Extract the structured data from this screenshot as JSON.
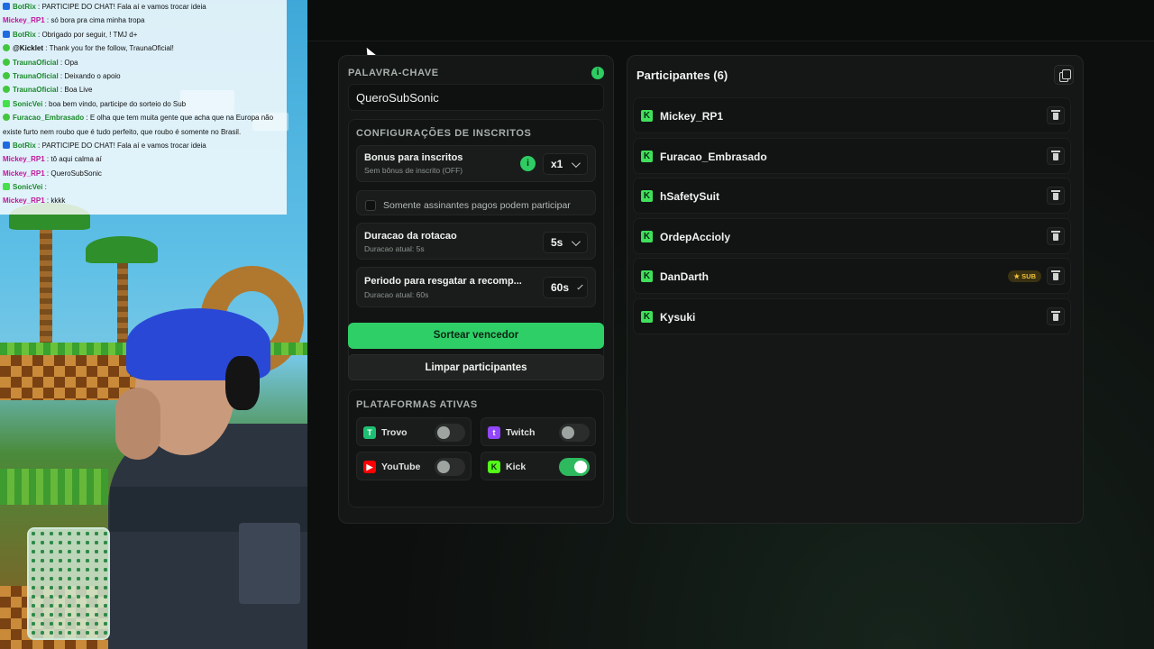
{
  "chat": [
    {
      "icon": "bot",
      "name": "BotRix",
      "name_color": "#1a8a2a",
      "text": "PARTICIPE DO CHAT! Fala aí e vamos trocar ideia"
    },
    {
      "icon": "none",
      "name": "Mickey_RP1",
      "name_color": "#c0159a",
      "text": "só bora pra cima minha tropa"
    },
    {
      "icon": "bot",
      "name": "BotRix",
      "name_color": "#1a8a2a",
      "text": "Obrigado por seguir, ! TMJ d+"
    },
    {
      "icon": "dot",
      "name": "@Kicklet",
      "name_color": "#111111",
      "text": "Thank you for the follow, TraunaOficial!"
    },
    {
      "icon": "dot",
      "name": "TraunaOficial",
      "name_color": "#1a8a2a",
      "text": "Opa"
    },
    {
      "icon": "dot",
      "name": "TraunaOficial",
      "name_color": "#1a8a2a",
      "text": "Deixando o apoio"
    },
    {
      "icon": "dot",
      "name": "TraunaOficial",
      "name_color": "#1a8a2a",
      "text": "Boa Live"
    },
    {
      "icon": "k",
      "name": "SonicVei",
      "name_color": "#1a8a2a",
      "text": "boa bem vindo, participe do sorteio do Sub"
    },
    {
      "icon": "dot",
      "name": "Furacao_Embrasado",
      "name_color": "#1a8a2a",
      "text": "E olha que tem muita gente que acha que na Europa não"
    },
    {
      "icon": "none",
      "name": "",
      "name_color": "#111111",
      "text": "existe furto nem roubo que é tudo perfeito, que roubo é somente no Brasil."
    },
    {
      "icon": "bot",
      "name": "BotRix",
      "name_color": "#1a8a2a",
      "text": "PARTICIPE DO CHAT! Fala aí e vamos trocar ideia"
    },
    {
      "icon": "none",
      "name": "Mickey_RP1",
      "name_color": "#c0159a",
      "text": "tô aqui calma aí"
    },
    {
      "icon": "none",
      "name": "Mickey_RP1",
      "name_color": "#c0159a",
      "text": "QueroSubSonic"
    },
    {
      "icon": "k",
      "name": "SonicVei",
      "name_color": "#1a8a2a",
      "text": ""
    },
    {
      "icon": "none",
      "name": "Mickey_RP1",
      "name_color": "#c0159a",
      "text": "kkkk"
    }
  ],
  "keyword": {
    "label": "PALAVRA-CHAVE",
    "info": "i",
    "value": "QueroSubSonic"
  },
  "subs_config": {
    "title": "CONFIGURAÇÕES DE INSCRITOS",
    "bonus": {
      "title": "Bonus para inscritos",
      "subtitle": "Sem bônus de inscrito (OFF)",
      "value": "x1"
    },
    "paid_only": {
      "label": "Somente assinantes pagos podem participar",
      "checked": false
    },
    "rotation": {
      "title": "Duracao da rotacao",
      "subtitle": "Duracao atual: 5s",
      "value": "5s"
    },
    "claim": {
      "title": "Periodo para resgatar a recomp...",
      "subtitle": "Duracao atual: 60s",
      "value": "60s"
    }
  },
  "buttons": {
    "draw": "Sortear vencedor",
    "clear": "Limpar participantes"
  },
  "platforms": {
    "title": "PLATAFORMAS ATIVAS",
    "items": [
      {
        "name": "Trovo",
        "icon": "trovo-icon",
        "color": "#1dbf73",
        "enabled": false
      },
      {
        "name": "Twitch",
        "icon": "twitch-icon",
        "color": "#9146ff",
        "enabled": false
      },
      {
        "name": "YouTube",
        "icon": "youtube-icon",
        "color": "#ff0000",
        "enabled": false
      },
      {
        "name": "Kick",
        "icon": "kick-icon",
        "color": "#53fc18",
        "enabled": true
      }
    ]
  },
  "participants": {
    "title": "Participantes (6)",
    "list": [
      {
        "name": "Mickey_RP1",
        "badge": ""
      },
      {
        "name": "Furacao_Embrasado",
        "badge": ""
      },
      {
        "name": "hSafetySuit",
        "badge": ""
      },
      {
        "name": "OrdepAccioly",
        "badge": ""
      },
      {
        "name": "DanDarth",
        "badge": "★ SUB"
      },
      {
        "name": "Kysuki",
        "badge": ""
      }
    ]
  },
  "colors": {
    "accent": "#2fcf68",
    "kick": "#53fc18",
    "panel": "#151716"
  }
}
